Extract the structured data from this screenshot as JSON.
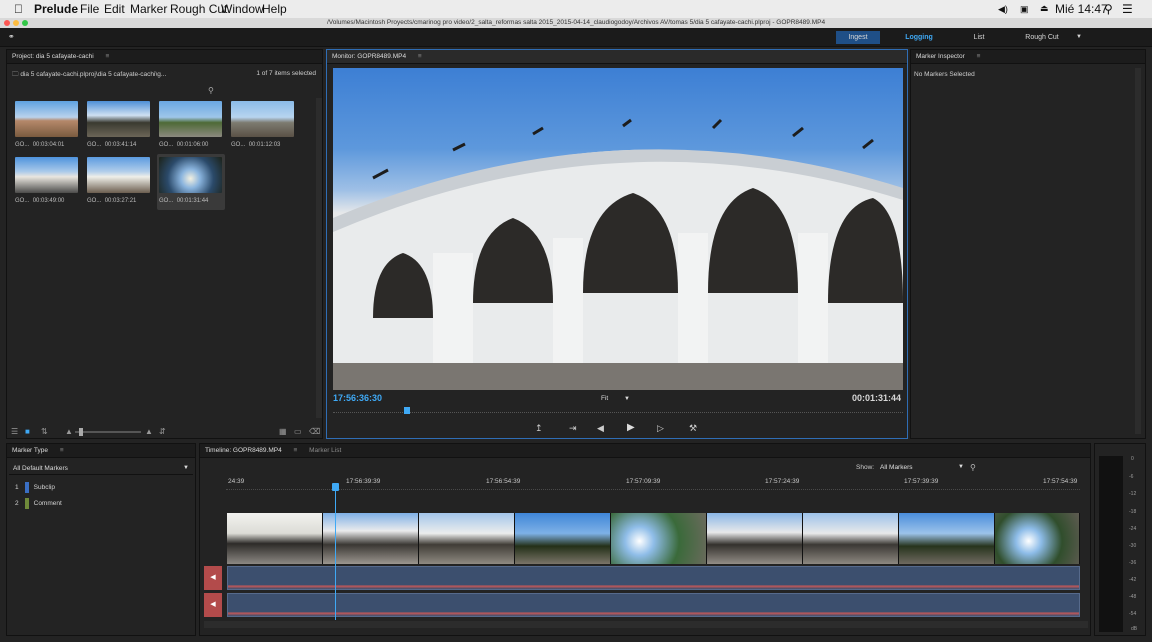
{
  "menubar": {
    "app": "Prelude",
    "items": [
      "File",
      "Edit",
      "Marker",
      "Rough Cut",
      "Window",
      "Help"
    ],
    "clock": "Mié 14:47"
  },
  "window": {
    "path": "/Volumes/Macintosh Proyects/cmarinog pro video/2_salta_reformas salta 2015_2015-04-14_claudiogodoy/Archivos AV/tomas 5/dia 5 cafayate-cachi.plproj - GOPR8489.MP4"
  },
  "workspaces": {
    "ingest": "Ingest",
    "logging": "Logging",
    "list": "List",
    "rough_cut": "Rough Cut"
  },
  "project": {
    "title": "Project: dia 5 cafayate-cachi",
    "breadcrumb": "dia 5 cafayate-cachi.plproj\\dia 5 cafayate-cachi\\g...",
    "selection": "1 of 7 items selected",
    "clips": [
      {
        "name": "GO...",
        "duration": "00:03:04:01"
      },
      {
        "name": "GO...",
        "duration": "00:03:41:14"
      },
      {
        "name": "GO...",
        "duration": "00:01:06:00"
      },
      {
        "name": "GO...",
        "duration": "00:01:12:03"
      },
      {
        "name": "GO...",
        "duration": "00:03:49:00"
      },
      {
        "name": "GO...",
        "duration": "00:03:27:21"
      },
      {
        "name": "GO...",
        "duration": "00:01:31:44"
      }
    ]
  },
  "monitor": {
    "title": "Monitor: GOPR8489.MP4",
    "timecode": "17:56:36:30",
    "fit": "Fit",
    "duration": "00:01:31:44",
    "playhead_fraction": 0.13
  },
  "inspector": {
    "title": "Marker Inspector",
    "empty": "No Markers Selected"
  },
  "marker_type": {
    "title": "Marker Type",
    "filter": "All Default Markers",
    "items": [
      {
        "num": "1",
        "label": "Subclip",
        "color": "#3a6fc4"
      },
      {
        "num": "2",
        "label": "Comment",
        "color": "#6f8a3a"
      }
    ]
  },
  "timeline": {
    "title": "Timeline: GOPR8489.MP4",
    "tab2": "Marker List",
    "show_label": "Show:",
    "show_value": "All Markers",
    "ruler": [
      "24:39",
      "17:56:39:39",
      "17:56:54:39",
      "17:57:09:39",
      "17:57:24:39",
      "17:57:39:39",
      "17:57:54:39"
    ]
  },
  "meter": {
    "labels": [
      "0",
      "-6",
      "-12",
      "-18",
      "-24",
      "-30",
      "-36",
      "-42",
      "-48",
      "-54",
      "dB"
    ]
  },
  "colors": {
    "accent": "#2f8ce0",
    "timecode": "#3fa9f5",
    "audio": "#3c4f6e",
    "waveform": "#d45a5a"
  }
}
